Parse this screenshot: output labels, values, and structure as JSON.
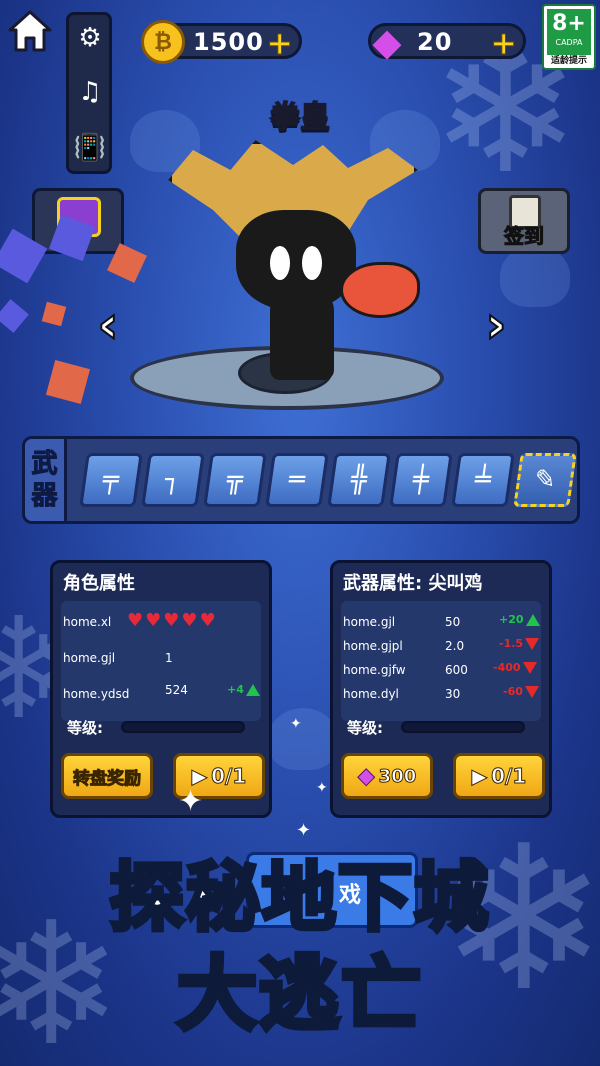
{
  "top_bar": {
    "gold": {
      "value": "1500",
      "icon": "gold-coin-icon"
    },
    "gems": {
      "value": "20",
      "icon": "diamond-icon"
    },
    "age_rating": {
      "rating": "8+",
      "org": "CADPA",
      "tip": "适龄提示"
    }
  },
  "character": {
    "name": "拳皇"
  },
  "buttons": {
    "sign_in": "签到"
  },
  "weapon_bar": {
    "label": [
      "武",
      "器"
    ],
    "slots": [
      "rifle",
      "pistol",
      "smg",
      "shotgun",
      "heavy-gun",
      "laser-gun",
      "sniper-rifle",
      "rooster-bat"
    ]
  },
  "role_panel": {
    "title": "角色属性",
    "rows": [
      {
        "key": "home.xl",
        "hearts": 5
      },
      {
        "key": "home.gjl",
        "value": "1"
      },
      {
        "key": "home.ydsd",
        "value": "524",
        "delta": "+4"
      }
    ],
    "level_label": "等级:",
    "btn_wheel": "转盘奖励",
    "btn_video": "0/1"
  },
  "weapon_panel": {
    "title": "武器属性: 尖叫鸡",
    "rows": [
      {
        "key": "home.gjl",
        "value": "50",
        "delta": "+20",
        "dir": "up"
      },
      {
        "key": "home.gjpl",
        "value": "2.0",
        "delta": "-1.5",
        "dir": "down"
      },
      {
        "key": "home.gjfw",
        "value": "600",
        "delta": "-400",
        "dir": "down"
      },
      {
        "key": "home.dyl",
        "value": "30",
        "delta": "-60",
        "dir": "down"
      }
    ],
    "level_label": "等级:",
    "btn_gems": "300",
    "btn_video": "0/1"
  },
  "hidden_btn": "戏",
  "headline": {
    "line1": "探秘地下城",
    "line2": "大逃亡"
  },
  "colors": {
    "up": "#21c44a",
    "down": "#e52a2a",
    "gold": "#f7d21e"
  }
}
